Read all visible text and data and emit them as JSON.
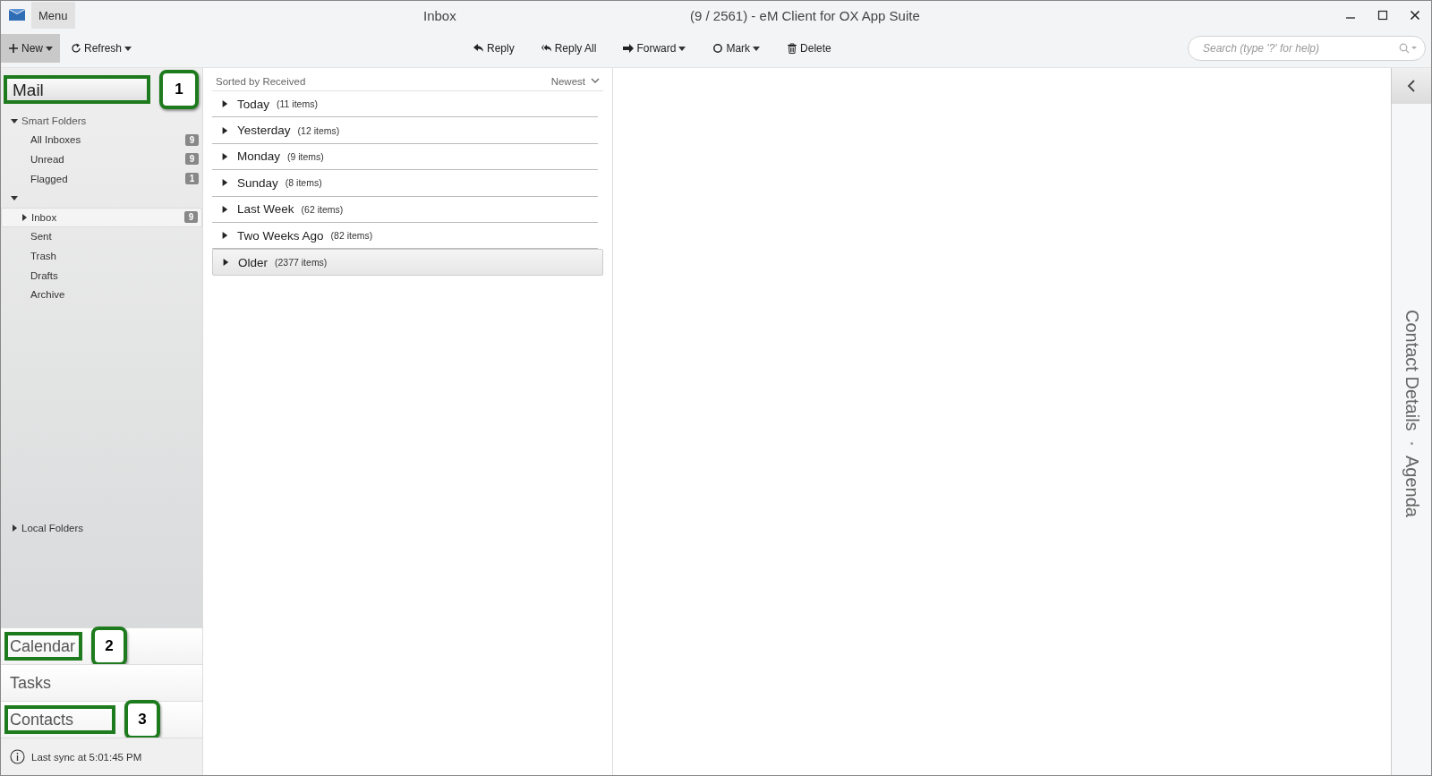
{
  "window": {
    "menu": "Menu",
    "title": "Inbox",
    "app_title": "(9 / 2561) - eM Client for OX App Suite"
  },
  "toolbar": {
    "left": [
      {
        "kind": "new",
        "label": "New",
        "dropdown": true,
        "selected": true
      },
      {
        "kind": "refresh",
        "label": "Refresh",
        "dropdown": true,
        "selected": false
      }
    ],
    "center": [
      {
        "kind": "reply",
        "label": "Reply",
        "dropdown": false
      },
      {
        "kind": "reply_all",
        "label": "Reply All",
        "dropdown": false
      },
      {
        "kind": "forward",
        "label": "Forward",
        "dropdown": true
      },
      {
        "kind": "mark",
        "label": "Mark",
        "dropdown": true
      },
      {
        "kind": "delete",
        "label": "Delete",
        "dropdown": false
      }
    ],
    "search": {
      "placeholder": "Search (type '?' for help)"
    }
  },
  "sidebar": {
    "header": {
      "label": "Mail",
      "highlighted": true,
      "callout": "1"
    },
    "tree": [
      {
        "label": "Smart Folders",
        "expanded": true,
        "children": [
          {
            "label": "All Inboxes",
            "count": "9",
            "selected": false
          },
          {
            "label": "Unread",
            "count": "9",
            "selected": false
          },
          {
            "label": "Flagged",
            "count": "1",
            "selected": false
          }
        ]
      },
      {
        "expanded": true,
        "children": [
          {
            "label": "Inbox",
            "count": "9",
            "expanded": false,
            "selected": true
          },
          {
            "label": "Sent",
            "selected": false
          },
          {
            "label": "Trash",
            "selected": false
          },
          {
            "label": "Drafts",
            "selected": false
          },
          {
            "label": "Archive",
            "selected": false
          }
        ]
      }
    ],
    "local_folders": {
      "label": "Local Folders",
      "expanded": false
    },
    "nav": [
      {
        "label": "Calendar",
        "highlighted": true,
        "callout": "2"
      },
      {
        "label": "Tasks",
        "highlighted": false
      },
      {
        "label": "Contacts",
        "highlighted": true,
        "callout": "3"
      }
    ],
    "status": "Last sync at 5:01:45 PM"
  },
  "message_list": {
    "sort_label": "Sorted by Received",
    "order": "Newest",
    "groups": [
      {
        "label": "Today",
        "count": "(11 items)",
        "selected": false
      },
      {
        "label": "Yesterday",
        "count": "(12 items)",
        "selected": false
      },
      {
        "label": "Monday",
        "count": "(9 items)",
        "selected": false
      },
      {
        "label": "Sunday",
        "count": "(8 items)",
        "selected": false
      },
      {
        "label": "Last Week",
        "count": "(62 items)",
        "selected": false
      },
      {
        "label": "Two Weeks Ago",
        "count": "(82 items)",
        "selected": false
      },
      {
        "label": "Older",
        "count": "(2377 items)",
        "selected": true
      }
    ]
  },
  "right_panel": {
    "tabs": [
      {
        "label": "Contact Details"
      },
      {
        "label": "Agenda"
      }
    ]
  }
}
